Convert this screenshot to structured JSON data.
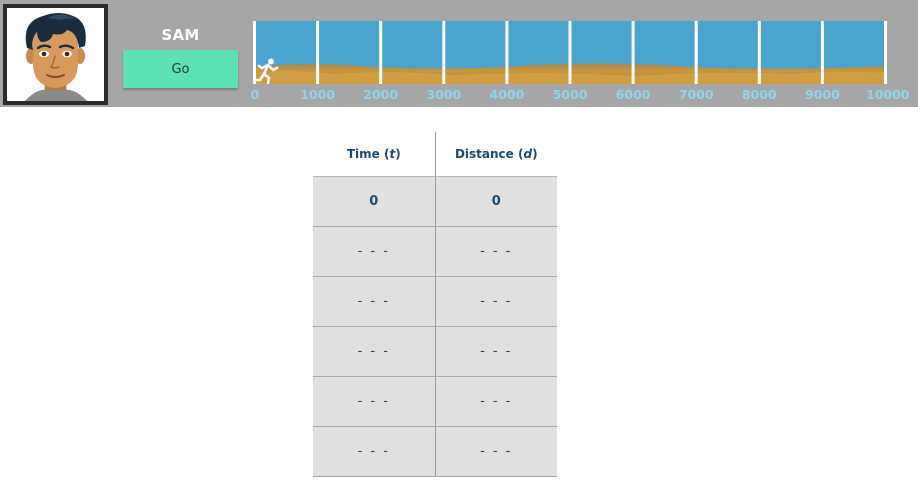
{
  "runner": {
    "name": "SAM",
    "go_label": "Go"
  },
  "track": {
    "tick_labels": [
      "0",
      "1000",
      "2000",
      "3000",
      "4000",
      "5000",
      "6000",
      "7000",
      "8000",
      "9000",
      "10000"
    ],
    "runner_position": 0,
    "colors": {
      "sky": "#4aa4cf",
      "ground": "#c9953d",
      "marker": "#ffffff",
      "tick_label": "#8dd4ef"
    }
  },
  "table": {
    "time_header": "Time (",
    "time_var": "t",
    "time_close": ")",
    "distance_header": "Distance (",
    "distance_var": "d",
    "distance_close": ")",
    "rows": [
      {
        "time": "0",
        "distance": "0"
      },
      {
        "time": "- - -",
        "distance": "- - -"
      },
      {
        "time": "- - -",
        "distance": "- - -"
      },
      {
        "time": "- - -",
        "distance": "- - -"
      },
      {
        "time": "- - -",
        "distance": "- - -"
      },
      {
        "time": "- - -",
        "distance": "- - -"
      }
    ]
  },
  "colors": {
    "topbar": "#a6a6a6",
    "go_button": "#5de0b4",
    "table_text": "#1c4a70",
    "table_cell": "#e0e0e0"
  }
}
